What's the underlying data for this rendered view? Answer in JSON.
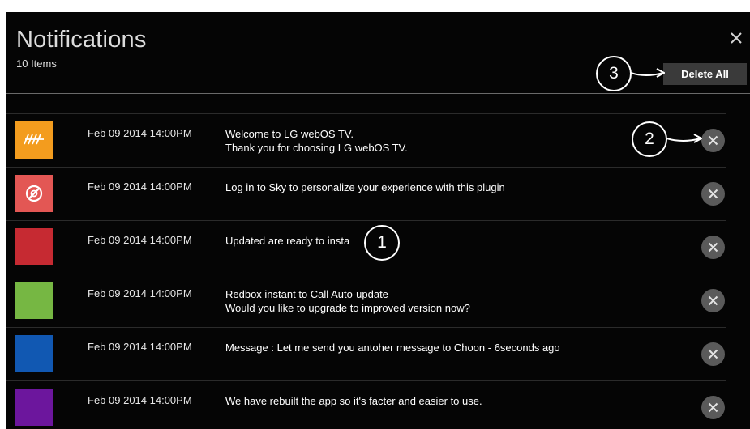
{
  "header": {
    "title": "Notifications",
    "count": "10 Items",
    "delete_all_label": "Delete All"
  },
  "icons": {
    "close": "close-icon",
    "dismiss": "circle-x-icon",
    "antenna": "antenna-icon",
    "no-signal": "no-signal-icon"
  },
  "notifications": [
    {
      "color": "#f39c1e",
      "icon": "antenna-icon",
      "date": "Feb 09 2014 14:00PM",
      "lines": [
        "Welcome to LG webOS TV.",
        "Thank you for choosing LG webOS TV."
      ]
    },
    {
      "color": "#e35754",
      "icon": "no-signal-icon",
      "date": "Feb 09 2014 14:00PM",
      "lines": [
        "Log in to Sky to personalize your experience with this plugin"
      ]
    },
    {
      "color": "#c62a32",
      "icon": "",
      "date": "Feb 09 2014 14:00PM",
      "lines": [
        "Updated are ready to insta"
      ]
    },
    {
      "color": "#76b743",
      "icon": "",
      "date": "Feb 09 2014 14:00PM",
      "lines": [
        "Redbox instant to Call Auto-update",
        "Would you like to upgrade to improved version now?"
      ]
    },
    {
      "color": "#1158b2",
      "icon": "",
      "date": "Feb 09 2014 14:00PM",
      "lines": [
        "Message : Let me send you antoher message to Choon - 6seconds ago"
      ]
    },
    {
      "color": "#6c169d",
      "icon": "",
      "date": "Feb 09 2014 14:00PM",
      "lines": [
        "We have rebuilt the app so it's facter and easier to use."
      ]
    }
  ],
  "callouts": {
    "one": "1",
    "two": "2",
    "three": "3"
  },
  "colors": {
    "background": "#050505",
    "delete_button": "#3a3a3a",
    "dismiss_button": "#5a5a5a"
  }
}
